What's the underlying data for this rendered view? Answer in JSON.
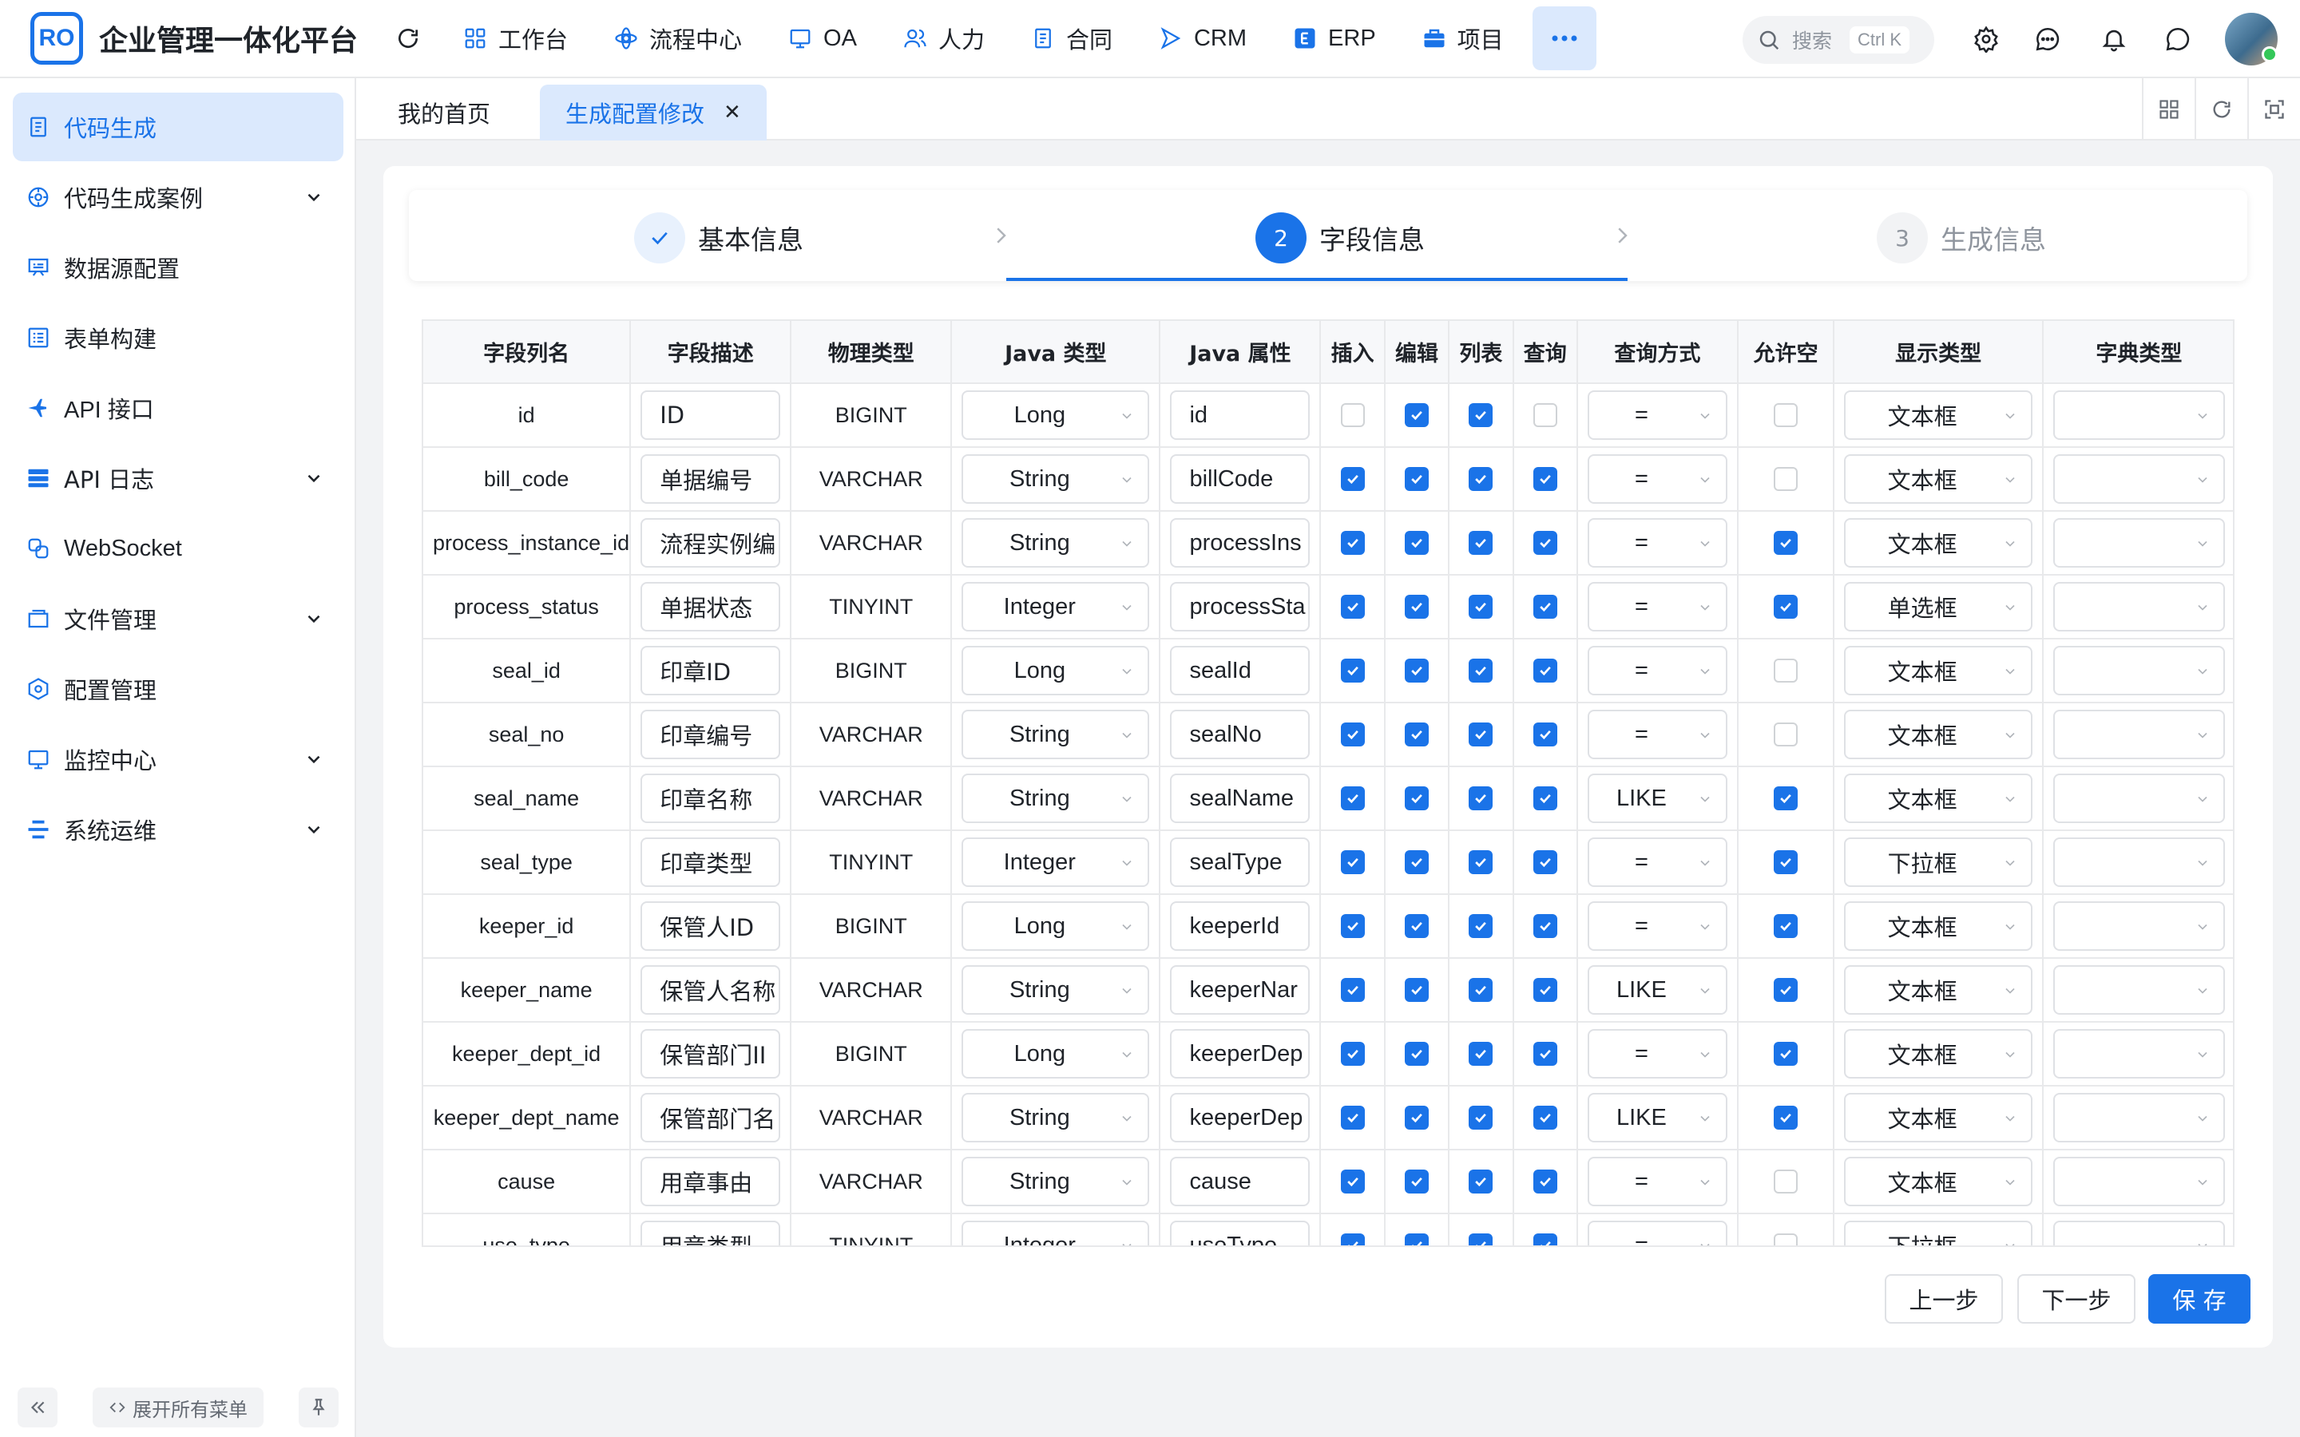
{
  "app": {
    "logo_mark": "RO",
    "title": "企业管理一体化平台"
  },
  "nav": [
    {
      "label": "工作台",
      "icon": "grid-icon"
    },
    {
      "label": "流程中心",
      "icon": "workflow-icon"
    },
    {
      "label": "OA",
      "icon": "monitor-icon"
    },
    {
      "label": "人力",
      "icon": "people-icon"
    },
    {
      "label": "合同",
      "icon": "document-icon"
    },
    {
      "label": "CRM",
      "icon": "crm-icon"
    },
    {
      "label": "ERP",
      "icon": "erp-icon"
    },
    {
      "label": "项目",
      "icon": "briefcase-icon"
    }
  ],
  "search": {
    "placeholder": "搜索",
    "shortcut": "Ctrl K"
  },
  "sidebar": {
    "items": [
      {
        "label": "代码生成",
        "active": true,
        "expandable": false
      },
      {
        "label": "代码生成案例",
        "expandable": true
      },
      {
        "label": "数据源配置",
        "expandable": false
      },
      {
        "label": "表单构建",
        "expandable": false
      },
      {
        "label": "API 接口",
        "expandable": false
      },
      {
        "label": "API 日志",
        "expandable": true
      },
      {
        "label": "WebSocket",
        "expandable": false
      },
      {
        "label": "文件管理",
        "expandable": true
      },
      {
        "label": "配置管理",
        "expandable": false
      },
      {
        "label": "监控中心",
        "expandable": true
      },
      {
        "label": "系统运维",
        "expandable": true
      }
    ],
    "expand_all": "展开所有菜单"
  },
  "tabs": [
    {
      "label": "我的首页",
      "active": false
    },
    {
      "label": "生成配置修改",
      "active": true,
      "closable": true
    }
  ],
  "steps": [
    {
      "label": "基本信息",
      "status": "done"
    },
    {
      "number": "2",
      "label": "字段信息",
      "status": "current"
    },
    {
      "number": "3",
      "label": "生成信息",
      "status": "todo"
    }
  ],
  "table": {
    "columns": [
      "字段列名",
      "字段描述",
      "物理类型",
      "Java 类型",
      "Java 属性",
      "插入",
      "编辑",
      "列表",
      "查询",
      "查询方式",
      "允许空",
      "显示类型",
      "字典类型"
    ],
    "rows": [
      {
        "name": "id",
        "desc": "ID",
        "phys": "BIGINT",
        "jtype": "Long",
        "jprop": "id",
        "ins": false,
        "edit": true,
        "list": true,
        "query": false,
        "qmode": "=",
        "nullable": false,
        "display": "文本框",
        "dict": ""
      },
      {
        "name": "bill_code",
        "desc": "单据编号",
        "phys": "VARCHAR",
        "jtype": "String",
        "jprop": "billCode",
        "ins": true,
        "edit": true,
        "list": true,
        "query": true,
        "qmode": "=",
        "nullable": false,
        "display": "文本框",
        "dict": ""
      },
      {
        "name": "process_instance_id",
        "desc": "流程实例编",
        "phys": "VARCHAR",
        "jtype": "String",
        "jprop": "processIns",
        "ins": true,
        "edit": true,
        "list": true,
        "query": true,
        "qmode": "=",
        "nullable": true,
        "display": "文本框",
        "dict": ""
      },
      {
        "name": "process_status",
        "desc": "单据状态",
        "phys": "TINYINT",
        "jtype": "Integer",
        "jprop": "processSta",
        "ins": true,
        "edit": true,
        "list": true,
        "query": true,
        "qmode": "=",
        "nullable": true,
        "display": "单选框",
        "dict": ""
      },
      {
        "name": "seal_id",
        "desc": "印章ID",
        "phys": "BIGINT",
        "jtype": "Long",
        "jprop": "sealId",
        "ins": true,
        "edit": true,
        "list": true,
        "query": true,
        "qmode": "=",
        "nullable": false,
        "display": "文本框",
        "dict": ""
      },
      {
        "name": "seal_no",
        "desc": "印章编号",
        "phys": "VARCHAR",
        "jtype": "String",
        "jprop": "sealNo",
        "ins": true,
        "edit": true,
        "list": true,
        "query": true,
        "qmode": "=",
        "nullable": false,
        "display": "文本框",
        "dict": ""
      },
      {
        "name": "seal_name",
        "desc": "印章名称",
        "phys": "VARCHAR",
        "jtype": "String",
        "jprop": "sealName",
        "ins": true,
        "edit": true,
        "list": true,
        "query": true,
        "qmode": "LIKE",
        "nullable": true,
        "display": "文本框",
        "dict": ""
      },
      {
        "name": "seal_type",
        "desc": "印章类型",
        "phys": "TINYINT",
        "jtype": "Integer",
        "jprop": "sealType",
        "ins": true,
        "edit": true,
        "list": true,
        "query": true,
        "qmode": "=",
        "nullable": true,
        "display": "下拉框",
        "dict": ""
      },
      {
        "name": "keeper_id",
        "desc": "保管人ID",
        "phys": "BIGINT",
        "jtype": "Long",
        "jprop": "keeperId",
        "ins": true,
        "edit": true,
        "list": true,
        "query": true,
        "qmode": "=",
        "nullable": true,
        "display": "文本框",
        "dict": ""
      },
      {
        "name": "keeper_name",
        "desc": "保管人名称",
        "phys": "VARCHAR",
        "jtype": "String",
        "jprop": "keeperNar",
        "ins": true,
        "edit": true,
        "list": true,
        "query": true,
        "qmode": "LIKE",
        "nullable": true,
        "display": "文本框",
        "dict": ""
      },
      {
        "name": "keeper_dept_id",
        "desc": "保管部门II",
        "phys": "BIGINT",
        "jtype": "Long",
        "jprop": "keeperDep",
        "ins": true,
        "edit": true,
        "list": true,
        "query": true,
        "qmode": "=",
        "nullable": true,
        "display": "文本框",
        "dict": ""
      },
      {
        "name": "keeper_dept_name",
        "desc": "保管部门名",
        "phys": "VARCHAR",
        "jtype": "String",
        "jprop": "keeperDep",
        "ins": true,
        "edit": true,
        "list": true,
        "query": true,
        "qmode": "LIKE",
        "nullable": true,
        "display": "文本框",
        "dict": ""
      },
      {
        "name": "cause",
        "desc": "用章事由",
        "phys": "VARCHAR",
        "jtype": "String",
        "jprop": "cause",
        "ins": true,
        "edit": true,
        "list": true,
        "query": true,
        "qmode": "=",
        "nullable": false,
        "display": "文本框",
        "dict": ""
      },
      {
        "name": "use_type",
        "desc": "用章类型",
        "phys": "TINYINT",
        "jtype": "Integer",
        "jprop": "useType",
        "ins": true,
        "edit": true,
        "list": true,
        "query": true,
        "qmode": "=",
        "nullable": false,
        "display": "下拉框",
        "dict": ""
      }
    ]
  },
  "buttons": {
    "prev": "上一步",
    "next": "下一步",
    "save": "保 存"
  },
  "colors": {
    "accent": "#1a73e8",
    "accent_light": "#dbe9fd",
    "border": "#e8e9eb"
  }
}
